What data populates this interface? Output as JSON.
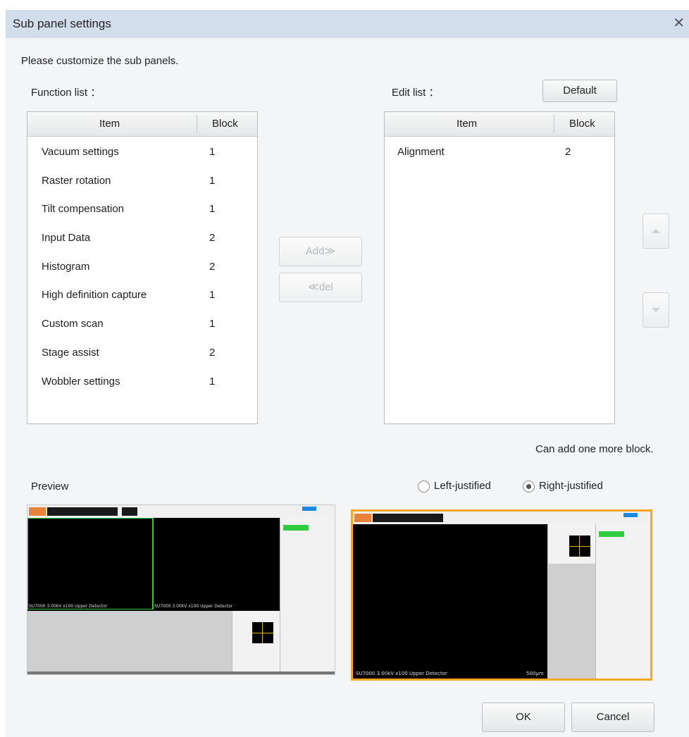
{
  "dialog": {
    "title": "Sub panel settings",
    "instruction": "Please customize the sub panels."
  },
  "function_list": {
    "label": "Function list ：",
    "columns": [
      "Item",
      "Block"
    ],
    "rows": [
      {
        "item": "Vacuum settings",
        "block": "1"
      },
      {
        "item": "Raster rotation",
        "block": "1"
      },
      {
        "item": "Tilt compensation",
        "block": "1"
      },
      {
        "item": "Input Data",
        "block": "2"
      },
      {
        "item": "Histogram",
        "block": "2"
      },
      {
        "item": "High definition capture",
        "block": "1"
      },
      {
        "item": "Custom scan",
        "block": "1"
      },
      {
        "item": "Stage assist",
        "block": "2"
      },
      {
        "item": "Wobbler settings",
        "block": "1"
      }
    ]
  },
  "edit_list": {
    "label": "Edit list ：",
    "default_label": "Default",
    "columns": [
      "Item",
      "Block"
    ],
    "rows": [
      {
        "item": "Alignment",
        "block": "2"
      }
    ]
  },
  "buttons": {
    "add": "Add≫",
    "del": "≪del",
    "ok": "OK",
    "cancel": "Cancel",
    "up_icon": "triangle-up-icon",
    "down_icon": "triangle-down-icon"
  },
  "status_text": "Can add one more block.",
  "preview": {
    "label": "Preview",
    "options": [
      "Left-justified",
      "Right-justified"
    ],
    "selected": "Right-justified",
    "left_caption_a": "SU7000 3.00kV x100 Upper Detector",
    "left_caption_b": "SU7000 3.00kV x100 Upper Detector",
    "right_caption": "SU7000 3.00kV x100 Upper Detector",
    "scale_label": "500µm"
  },
  "colors": {
    "titlebar": "#d3deec",
    "selected_preview_border": "#f5a623",
    "accent_green": "#2ecc40"
  }
}
